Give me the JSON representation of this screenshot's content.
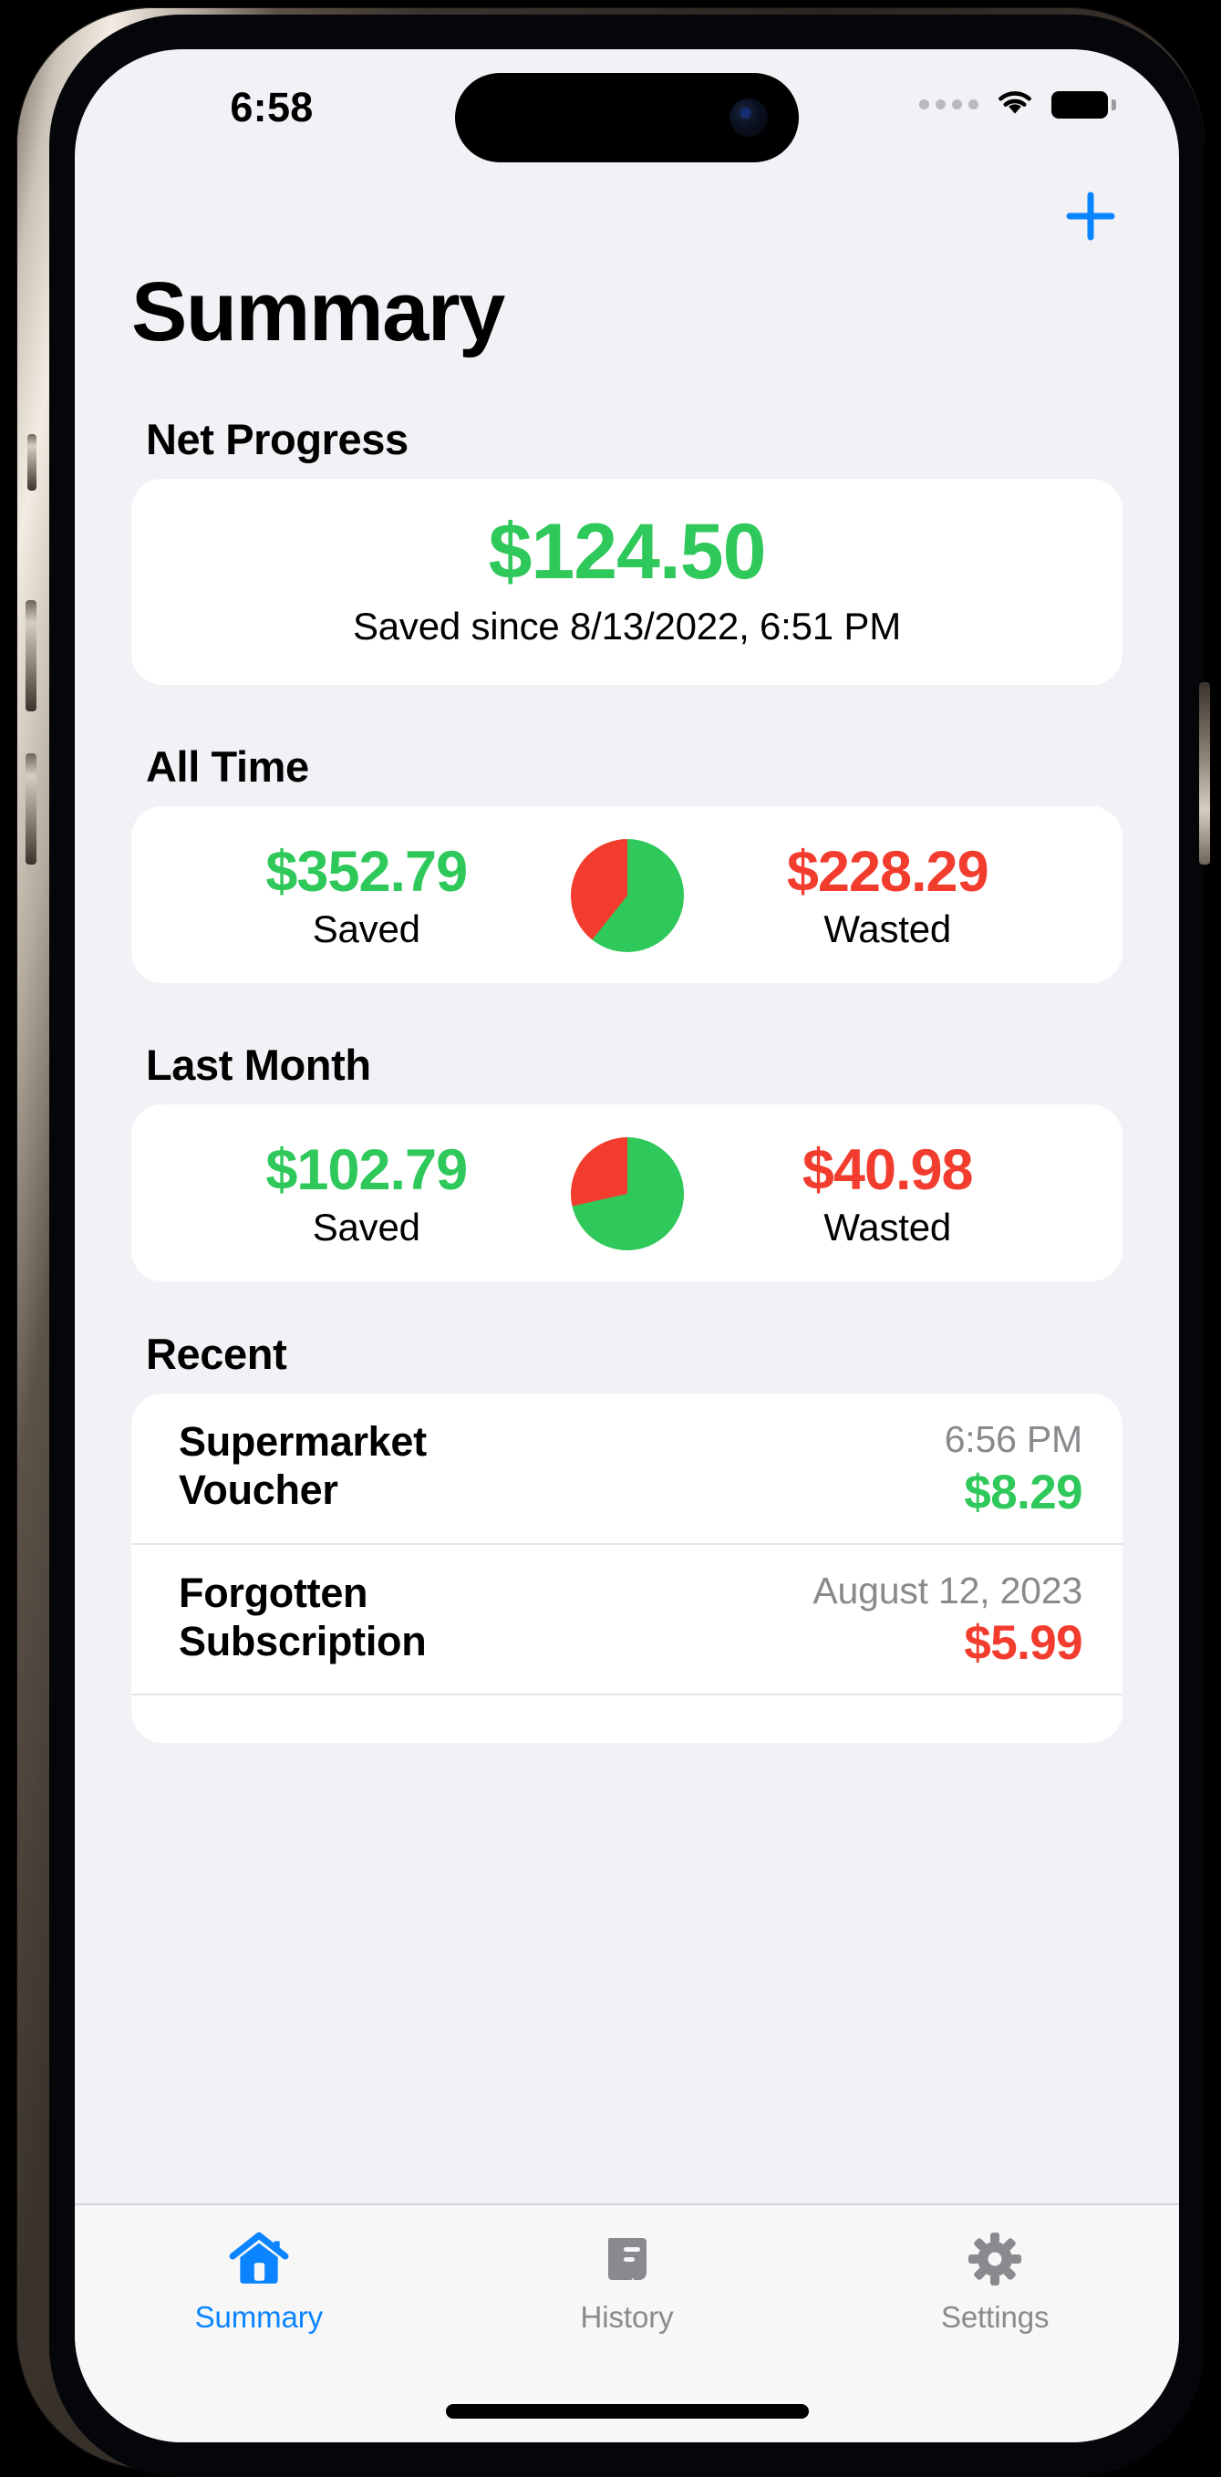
{
  "status_bar": {
    "time": "6:58",
    "cellular_icon": "cellular-dots-icon",
    "wifi_icon": "wifi-icon",
    "battery_icon": "battery-full-icon"
  },
  "nav": {
    "add_icon": "plus-icon",
    "add_label": "+"
  },
  "header": {
    "title": "Summary"
  },
  "colors": {
    "saved_green": "#2FC85A",
    "wasted_red": "#F23C2E",
    "accent_blue": "#0A84FF",
    "inactive_gray": "#8A8A8E",
    "background": "#F1F1F6",
    "card": "#FFFFFF"
  },
  "net_progress": {
    "section_title": "Net Progress",
    "amount": "$124.50",
    "subtitle": "Saved since 8/13/2022, 6:51 PM"
  },
  "all_time": {
    "section_title": "All Time",
    "saved_amount": "$352.79",
    "saved_label": "Saved",
    "wasted_amount": "$228.29",
    "wasted_label": "Wasted"
  },
  "last_month": {
    "section_title": "Last Month",
    "saved_amount": "$102.79",
    "saved_label": "Saved",
    "wasted_amount": "$40.98",
    "wasted_label": "Wasted"
  },
  "recent": {
    "section_title": "Recent",
    "items": [
      {
        "name": "Supermarket Voucher",
        "time": "6:56 PM",
        "amount": "$8.29",
        "kind": "saved"
      },
      {
        "name": "Forgotten Subscription",
        "time": "August 12, 2023",
        "amount": "$5.99",
        "kind": "wasted"
      }
    ]
  },
  "tab_bar": {
    "items": [
      {
        "label": "Summary",
        "icon": "house-icon",
        "active": true
      },
      {
        "label": "History",
        "icon": "scroll-icon",
        "active": false
      },
      {
        "label": "Settings",
        "icon": "gear-icon",
        "active": false
      }
    ]
  },
  "chart_data": [
    {
      "type": "pie",
      "title": "All Time",
      "categories": [
        "Saved",
        "Wasted"
      ],
      "values": [
        352.79,
        228.29
      ],
      "percentages": [
        60.7,
        39.3
      ],
      "colors": [
        "#2FC85A",
        "#F23C2E"
      ],
      "legend": "inline-amounts",
      "xlabel": "",
      "ylabel": ""
    },
    {
      "type": "pie",
      "title": "Last Month",
      "categories": [
        "Saved",
        "Wasted"
      ],
      "values": [
        102.79,
        40.98
      ],
      "percentages": [
        71.5,
        28.5
      ],
      "colors": [
        "#2FC85A",
        "#F23C2E"
      ],
      "legend": "inline-amounts",
      "xlabel": "",
      "ylabel": ""
    }
  ]
}
